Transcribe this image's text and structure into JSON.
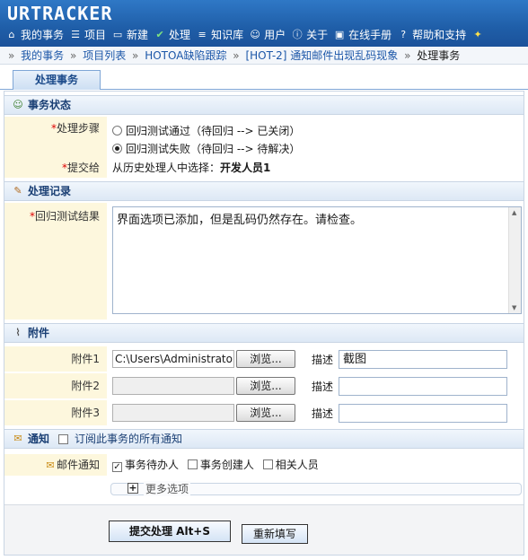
{
  "app": {
    "logo": "URTRACKER"
  },
  "menu": [
    {
      "label": "我的事务",
      "icon": "home-icon"
    },
    {
      "label": "项目",
      "icon": "database-icon"
    },
    {
      "label": "新建",
      "icon": "new-icon"
    },
    {
      "label": "处理",
      "icon": "check-icon"
    },
    {
      "label": "知识库",
      "icon": "books-icon"
    },
    {
      "label": "用户",
      "icon": "users-icon"
    },
    {
      "label": "关于",
      "icon": "info-icon"
    },
    {
      "label": "在线手册",
      "icon": "manual-icon"
    },
    {
      "label": "帮助和支持",
      "icon": "help-icon"
    }
  ],
  "breadcrumb": {
    "sep": "»",
    "items": [
      "我的事务",
      "项目列表",
      "HOTOA缺陷跟踪",
      "[HOT-2] 通知邮件出现乱码现象"
    ],
    "current": "处理事务"
  },
  "tab": {
    "label": "处理事务"
  },
  "status_section": {
    "title": "事务状态",
    "step_label": "处理步骤",
    "options": [
      {
        "label": "回归测试通过（待回归 --> 已关闭）",
        "selected": false
      },
      {
        "label": "回归测试失败（待回归 --> 待解决）",
        "selected": true
      }
    ],
    "assign_label": "提交给",
    "assign_prefix": "从历史处理人中选择：",
    "assign_value": "开发人员1"
  },
  "record_section": {
    "title": "处理记录",
    "field_label": "回归测试结果",
    "field_value": "界面选项已添加，但是乱码仍然存在。请检查。"
  },
  "attach_section": {
    "title": "附件",
    "browse_label": "浏览...",
    "desc_label": "描述",
    "items": [
      {
        "label": "附件1",
        "path": "C:\\Users\\Administrator\\",
        "desc": "截图"
      },
      {
        "label": "附件2",
        "path": "",
        "desc": ""
      },
      {
        "label": "附件3",
        "path": "",
        "desc": ""
      }
    ]
  },
  "notify_section": {
    "title": "通知",
    "subscribe_label": "订阅此事务的所有通知",
    "mail_label": "邮件通知",
    "options": [
      {
        "label": "事务待办人",
        "checked": true
      },
      {
        "label": "事务创建人",
        "checked": false
      },
      {
        "label": "相关人员",
        "checked": false
      }
    ],
    "more_label": "更多选项"
  },
  "actions": {
    "submit_label": "提交处理  Alt+S",
    "reset_label": "重新填写"
  }
}
